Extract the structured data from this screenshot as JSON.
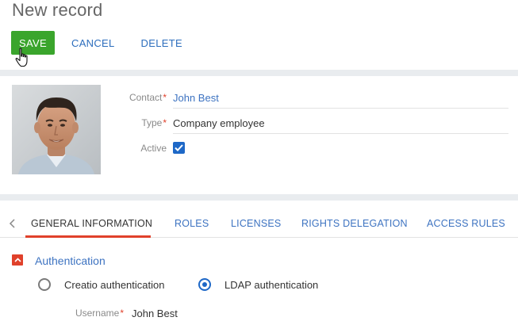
{
  "page": {
    "title": "New record"
  },
  "toolbar": {
    "save_label": "SAVE",
    "cancel_label": "CANCEL",
    "delete_label": "DELETE"
  },
  "profile": {
    "fields": {
      "contact": {
        "label": "Contact",
        "required": "*",
        "value": "John Best"
      },
      "type": {
        "label": "Type",
        "required": "*",
        "value": "Company employee"
      },
      "active": {
        "label": "Active",
        "checked": true
      }
    }
  },
  "tabs": {
    "items": [
      {
        "label": "GENERAL INFORMATION",
        "active": true
      },
      {
        "label": "ROLES"
      },
      {
        "label": "LICENSES"
      },
      {
        "label": "RIGHTS DELEGATION"
      },
      {
        "label": "ACCESS RULES"
      }
    ]
  },
  "authentication": {
    "section_title": "Authentication",
    "options": [
      {
        "label": "Creatio authentication",
        "selected": false
      },
      {
        "label": "LDAP authentication",
        "selected": true
      }
    ],
    "username": {
      "label": "Username",
      "required": "*",
      "value": "John Best"
    }
  },
  "colors": {
    "save_button": "#3aa52c",
    "link": "#3d73c1",
    "accent_red": "#e0412b",
    "checkbox": "#1e68c7"
  }
}
